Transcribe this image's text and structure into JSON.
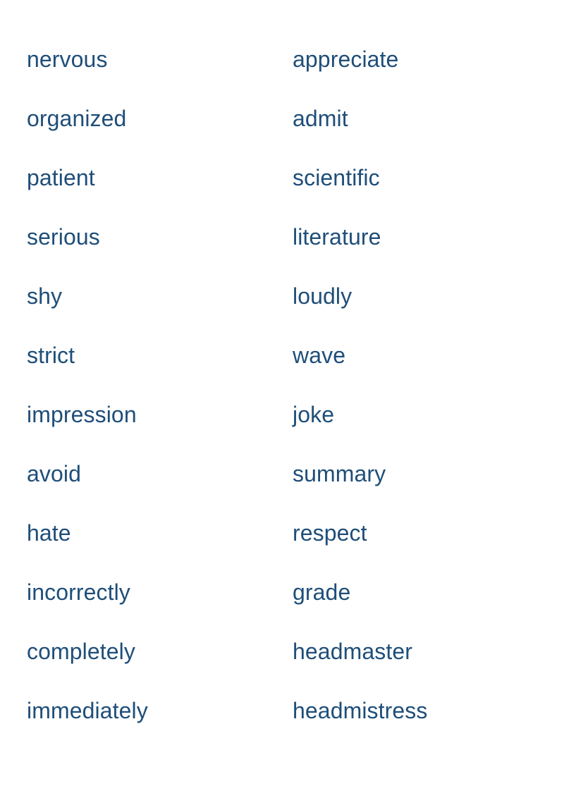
{
  "page": {
    "kind": "vocabulary-word-list",
    "background_color": "#ffffff",
    "text_color": "#1F4E79",
    "column_count": 2,
    "row_count": 12,
    "total_words": 24
  },
  "columns": [
    {
      "name": "left-column",
      "words": [
        "nervous",
        "organized",
        "patient",
        "serious",
        "shy",
        "strict",
        "impression",
        "avoid",
        "hate",
        "incorrectly",
        "completely",
        "immediately"
      ]
    },
    {
      "name": "right-column",
      "words": [
        "appreciate",
        "admit",
        "scientific",
        "literature",
        "loudly",
        "wave",
        "joke",
        "summary",
        "respect",
        "grade",
        "headmaster",
        "headmistress"
      ]
    }
  ],
  "rows": [
    {
      "left": "nervous",
      "right": "appreciate"
    },
    {
      "left": "organized",
      "right": "admit"
    },
    {
      "left": "patient",
      "right": "scientific"
    },
    {
      "left": "serious",
      "right": "literature"
    },
    {
      "left": "shy",
      "right": "loudly"
    },
    {
      "left": "strict",
      "right": "wave"
    },
    {
      "left": "impression",
      "right": "joke"
    },
    {
      "left": "avoid",
      "right": "summary"
    },
    {
      "left": "hate",
      "right": "respect"
    },
    {
      "left": "incorrectly",
      "right": "grade"
    },
    {
      "left": "completely",
      "right": "headmaster"
    },
    {
      "left": "immediately",
      "right": "headmistress"
    }
  ]
}
